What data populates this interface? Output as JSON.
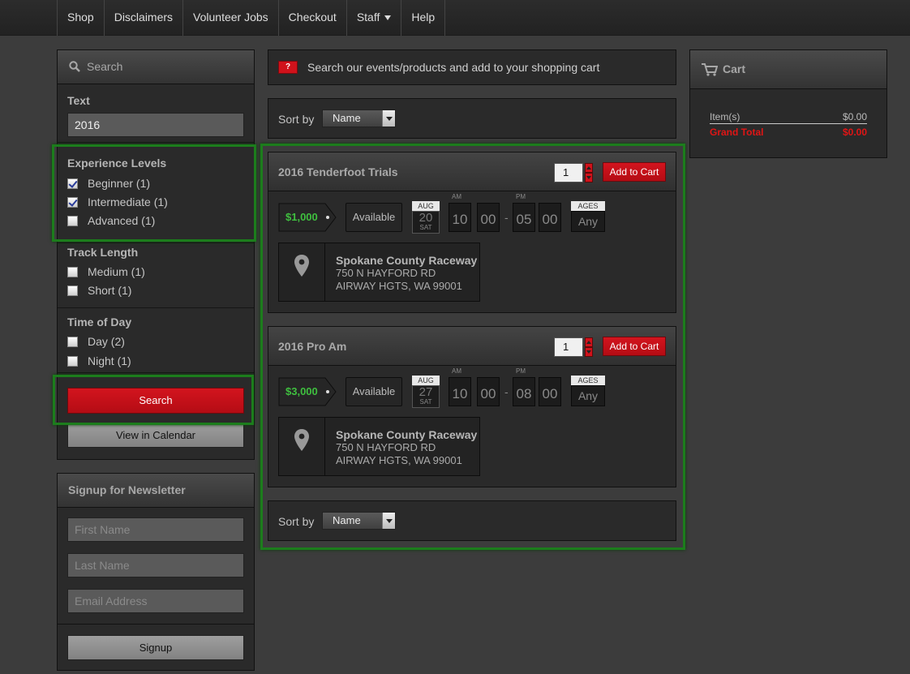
{
  "nav": {
    "items": [
      "Shop",
      "Disclaimers",
      "Volunteer Jobs",
      "Checkout",
      "Staff",
      "Help"
    ]
  },
  "search": {
    "header": "Search",
    "text_label": "Text",
    "text_value": "2016",
    "experience": {
      "title": "Experience Levels",
      "options": [
        {
          "label": "Beginner (1)",
          "checked": true
        },
        {
          "label": "Intermediate (1)",
          "checked": true
        },
        {
          "label": "Advanced (1)",
          "checked": false
        }
      ]
    },
    "track": {
      "title": "Track Length",
      "options": [
        {
          "label": "Medium (1)",
          "checked": false
        },
        {
          "label": "Short (1)",
          "checked": false
        }
      ]
    },
    "time": {
      "title": "Time of Day",
      "options": [
        {
          "label": "Day (2)",
          "checked": false
        },
        {
          "label": "Night (1)",
          "checked": false
        }
      ]
    },
    "search_button": "Search",
    "calendar_button": "View in Calendar"
  },
  "newsletter": {
    "header": "Signup for Newsletter",
    "first_name_placeholder": "First Name",
    "last_name_placeholder": "Last Name",
    "email_placeholder": "Email Address",
    "signup_button": "Signup"
  },
  "info": {
    "badge": "?",
    "text": "Search our events/products and add to your shopping cart"
  },
  "sort": {
    "label": "Sort by",
    "value": "Name"
  },
  "events": [
    {
      "title": "2016 Tenderfoot Trials",
      "qty": "1",
      "add_label": "Add to Cart",
      "price": "$1,000",
      "status": "Available",
      "month": "AUG",
      "day": "20",
      "weekday": "SAT",
      "start_ampm": "AM",
      "start_hour": "10",
      "start_min": "00",
      "end_ampm": "PM",
      "end_hour": "05",
      "end_min": "00",
      "ages_label": "AGES",
      "ages_value": "Any",
      "venue_name": "Spokane County Raceway",
      "venue_addr1": "750 N HAYFORD RD",
      "venue_addr2": "AIRWAY HGTS, WA 99001"
    },
    {
      "title": "2016 Pro Am",
      "qty": "1",
      "add_label": "Add to Cart",
      "price": "$3,000",
      "status": "Available",
      "month": "AUG",
      "day": "27",
      "weekday": "SAT",
      "start_ampm": "AM",
      "start_hour": "10",
      "start_min": "00",
      "end_ampm": "PM",
      "end_hour": "08",
      "end_min": "00",
      "ages_label": "AGES",
      "ages_value": "Any",
      "venue_name": "Spokane County Raceway",
      "venue_addr1": "750 N HAYFORD RD",
      "venue_addr2": "AIRWAY HGTS, WA 99001"
    }
  ],
  "cart": {
    "header": "Cart",
    "items_label": "Item(s)",
    "items_value": "$0.00",
    "total_label": "Grand Total",
    "total_value": "$0.00"
  },
  "colors": {
    "accent_red": "#d0121b",
    "highlight_green": "#1c7d1c",
    "price_green": "#3fbf3f"
  }
}
